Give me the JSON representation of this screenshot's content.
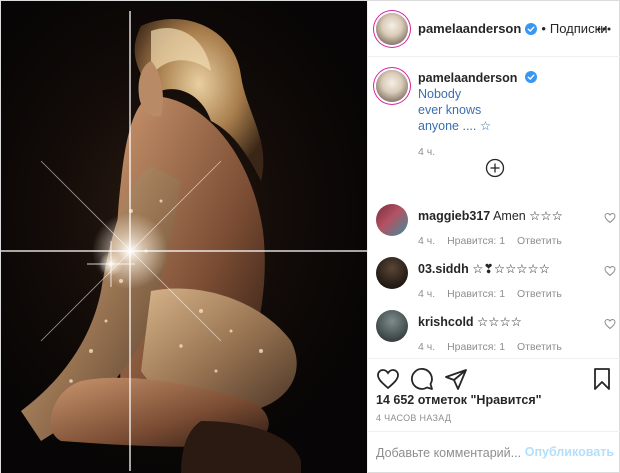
{
  "post": {
    "author": "pamelaanderson",
    "follow_separator": "•",
    "follow_label": "Подписки",
    "caption": {
      "author": "pamelaanderson",
      "text_line1": "Nobody",
      "text_line2": "ever knows",
      "text_line3": "anyone .... ☆",
      "time": "4 ч."
    },
    "comments": [
      {
        "user": "maggieb317",
        "text": "Amen ☆☆☆",
        "time": "4 ч.",
        "likes": "Нравится: 1",
        "reply": "Ответить"
      },
      {
        "user": "03.siddh",
        "text": "☆❣☆☆☆☆☆",
        "time": "4 ч.",
        "likes": "Нравится: 1",
        "reply": "Ответить"
      },
      {
        "user": "krishcold",
        "text": "☆☆☆☆",
        "time": "4 ч.",
        "likes": "Нравится: 1",
        "reply": "Ответить"
      }
    ],
    "likes_text": "14 652 отметок \"Нравится\"",
    "posted_ago": "4 ЧАСОВ НАЗАД",
    "comment_placeholder": "Добавьте комментарий...",
    "publish_label": "Опубликовать"
  },
  "icons": {
    "verified": "verified-badge-icon",
    "more": "more-options-icon",
    "load_more": "plus-circle-icon",
    "heart": "heart-icon",
    "comment": "comment-bubble-icon",
    "share": "paper-plane-icon",
    "save": "bookmark-icon"
  },
  "colors": {
    "verified_blue": "#3897f0",
    "link_blue": "#3a6fb0",
    "publish_disabled": "#b2dffc"
  }
}
